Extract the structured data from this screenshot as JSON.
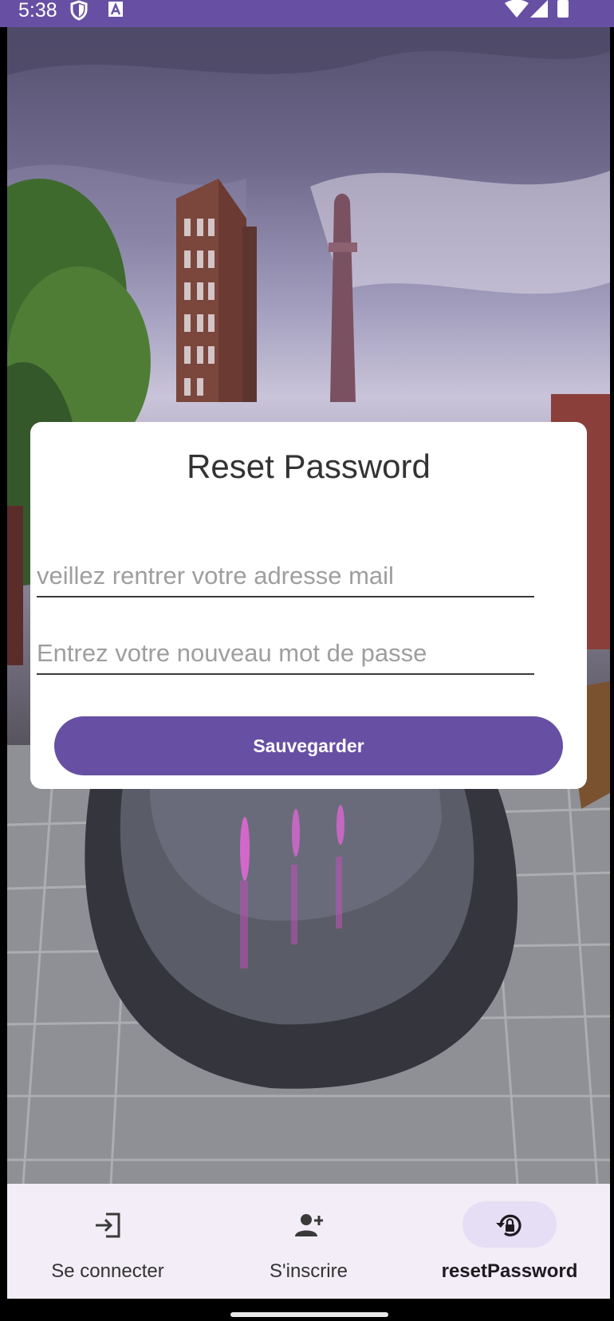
{
  "status_bar": {
    "time": "5:38",
    "left_icons": [
      "shield-icon",
      "keyboard-a-icon"
    ],
    "right_icons": [
      "wifi-icon",
      "signal-icon",
      "battery-icon"
    ]
  },
  "background": {
    "description_icon": "city-fountain-photo"
  },
  "card": {
    "title": "Reset Password",
    "email_placeholder": "veillez rentrer votre adresse mail",
    "email_value": "",
    "password_placeholder": "Entrez votre nouveau mot de passe",
    "password_value": "",
    "save_label": "Sauvegarder"
  },
  "nav": {
    "items": [
      {
        "label": "Se connecter",
        "icon": "login-icon",
        "active": false
      },
      {
        "label": "S'inscrire",
        "icon": "person-add-icon",
        "active": false
      },
      {
        "label": "resetPassword",
        "icon": "lock-reset-icon",
        "active": true
      }
    ]
  },
  "colors": {
    "primary": "#6750a4",
    "nav_background": "#f2edf6",
    "active_pill": "#e6def4"
  }
}
